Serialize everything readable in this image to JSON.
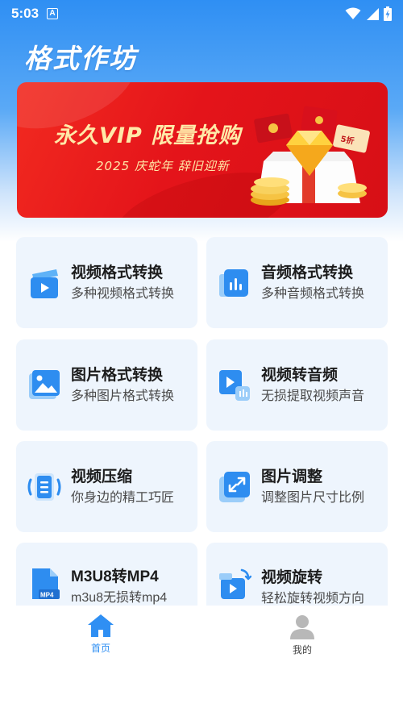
{
  "status_bar": {
    "time": "5:03",
    "notification_icon": "a-icon",
    "wifi_icon": "wifi-icon",
    "signal_icon": "signal-icon",
    "battery_icon": "battery-charging-icon"
  },
  "app": {
    "title": "格式作坊"
  },
  "banner": {
    "title": "永久VIP 限量抢购",
    "subtitle": "2025 庆蛇年 辞旧迎新",
    "discount_tag": "5折"
  },
  "tools": [
    {
      "title": "视频格式转换",
      "desc": "多种视频格式转换",
      "icon": "video-file-icon"
    },
    {
      "title": "音频格式转换",
      "desc": "多种音频格式转换",
      "icon": "audio-file-icon"
    },
    {
      "title": "图片格式转换",
      "desc": "多种图片格式转换",
      "icon": "image-file-icon"
    },
    {
      "title": "视频转音频",
      "desc": "无损提取视频声音",
      "icon": "video-to-audio-icon"
    },
    {
      "title": "视频压缩",
      "desc": "你身边的精工巧匠",
      "icon": "compress-icon"
    },
    {
      "title": "图片调整",
      "desc": "调整图片尺寸比例",
      "icon": "resize-icon"
    },
    {
      "title": "M3U8转MP4",
      "desc": "m3u8无损转mp4",
      "icon": "mp4-file-icon"
    },
    {
      "title": "视频旋转",
      "desc": "轻松旋转视频方向",
      "icon": "rotate-video-icon"
    }
  ],
  "bottom_nav": {
    "home_label": "首页",
    "mine_label": "我的",
    "active_color": "#2f8ff3",
    "inactive_color": "#444444"
  },
  "colors": {
    "accent": "#2f8ff3",
    "banner_red": "#e4141a",
    "banner_gold": "#ffe9a8",
    "card_bg": "#eef5fd"
  }
}
